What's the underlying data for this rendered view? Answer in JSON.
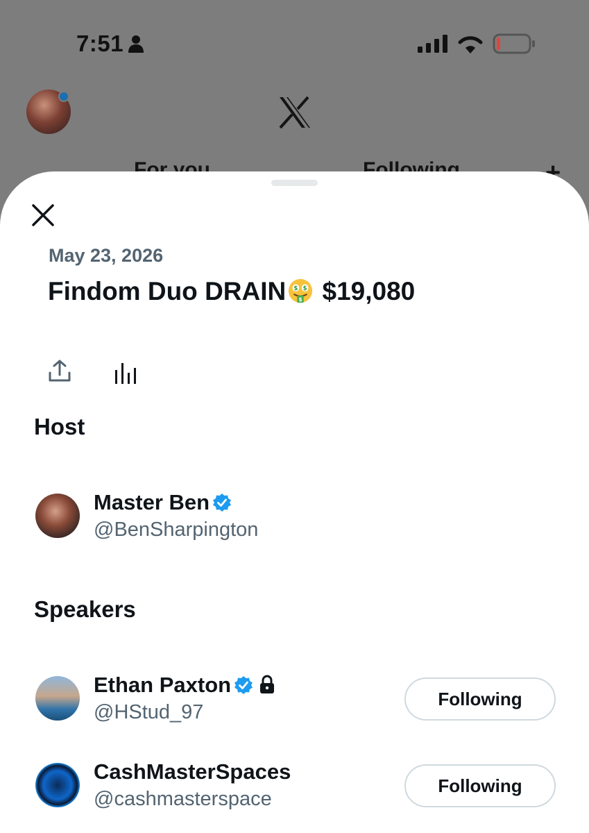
{
  "status_bar": {
    "time": "7:51",
    "icons": [
      "person-icon",
      "signal-icon",
      "wifi-icon",
      "battery-icon"
    ],
    "battery_color": "#e0463c"
  },
  "background_app": {
    "logo": "x-logo",
    "tabs": [
      {
        "label": "For you"
      },
      {
        "label": "Following"
      }
    ],
    "plus_label": "+"
  },
  "sheet": {
    "close_icon": "close-icon",
    "date": "May 23, 2026",
    "title": {
      "prefix": "Findom Duo DRAIN",
      "emoji": "money-mouth-face",
      "amount": "$19,080"
    },
    "actions": [
      "share-icon",
      "stats-icon"
    ],
    "host_heading": "Host",
    "host": {
      "name": "Master Ben",
      "handle": "@BenSharpington",
      "verified": true
    },
    "speakers_heading": "Speakers",
    "speakers": [
      {
        "name": "Ethan Paxton",
        "handle": "@HStud_97",
        "verified": true,
        "protected": true,
        "button_label": "Following"
      },
      {
        "name": "CashMasterSpaces",
        "handle": "@cashmasterspace",
        "verified": false,
        "protected": false,
        "button_label": "Following"
      }
    ]
  },
  "colors": {
    "accent_verified": "#1d9bf0",
    "text_primary": "#0f1419",
    "text_secondary": "#536471",
    "overlay": "#7d7d7d"
  }
}
